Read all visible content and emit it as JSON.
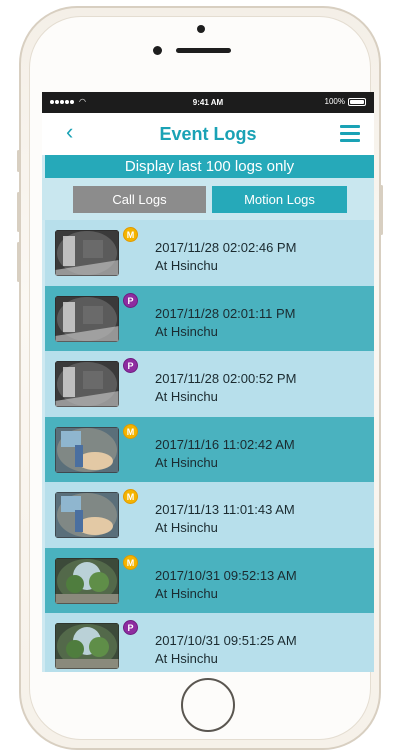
{
  "status_bar": {
    "time": "9:41 AM",
    "battery": "100%"
  },
  "nav": {
    "back_glyph": "‹",
    "title": "Event Logs"
  },
  "notice": "Display last 100 logs only",
  "tabs": {
    "call": "Call Logs",
    "motion": "Motion Logs",
    "active": "motion"
  },
  "logs": [
    {
      "badge": "M",
      "datetime": "2017/11/28 02:02:46 PM",
      "location": "At Hsinchu",
      "scene": "indoor-dark"
    },
    {
      "badge": "P",
      "datetime": "2017/11/28 02:01:11 PM",
      "location": "At Hsinchu",
      "scene": "indoor-dark"
    },
    {
      "badge": "P",
      "datetime": "2017/11/28 02:00:52 PM",
      "location": "At Hsinchu",
      "scene": "indoor-dark"
    },
    {
      "badge": "M",
      "datetime": "2017/11/16 11:02:42 AM",
      "location": "At Hsinchu",
      "scene": "indoor-color"
    },
    {
      "badge": "M",
      "datetime": "2017/11/13 11:01:43 AM",
      "location": "At Hsinchu",
      "scene": "indoor-color"
    },
    {
      "badge": "M",
      "datetime": "2017/10/31 09:52:13 AM",
      "location": "At Hsinchu",
      "scene": "outdoor"
    },
    {
      "badge": "P",
      "datetime": "2017/10/31 09:51:25 AM",
      "location": "At Hsinchu",
      "scene": "outdoor"
    }
  ],
  "colors": {
    "accent": "#1aa2b5",
    "row_light": "#b7dfeb",
    "row_dark": "#4ab2bf",
    "badge_motion": "#f4b400",
    "badge_people": "#8e2ca0",
    "tab_inactive": "#8c8c8c"
  }
}
